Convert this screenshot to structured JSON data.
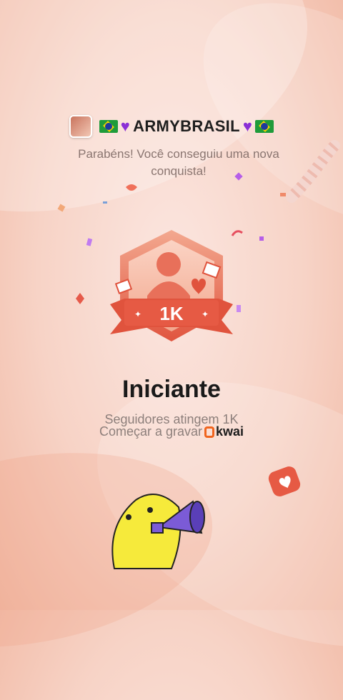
{
  "header": {
    "avatar_icon": "avatar-photo",
    "username": "ARMYBRASIL",
    "decoration_left": [
      "brazil-flag-icon",
      "purple-heart-icon"
    ],
    "decoration_right": [
      "purple-heart-icon",
      "brazil-flag-icon"
    ]
  },
  "congrats_line1": "Parabéns! Você conseguiu uma nova",
  "congrats_line2": "conquista!",
  "badge": {
    "label": "1K",
    "icon": "follower-badge-icon"
  },
  "title": "Iniciante",
  "subtitle": "Seguidores atingem 1K",
  "cta_text": "Começar a gravar",
  "brand": "kwai",
  "colors": {
    "accent": "#e0533d",
    "brand": "#f0641e",
    "heart": "#8b2fd6"
  }
}
